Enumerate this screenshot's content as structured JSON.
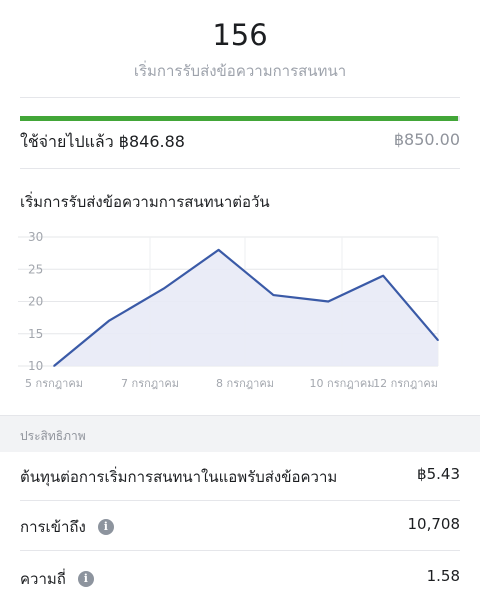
{
  "summary": {
    "count": "156",
    "count_label": "เริ่มการรับส่งข้อความการสนทนา"
  },
  "budget": {
    "spent_label": "ใช้จ่ายไปแล้ว ฿846.88",
    "total_label": "฿850.00",
    "progress_fraction": 0.9963,
    "bar_color": "#42a638"
  },
  "chart": {
    "title": "เริ่มการรับส่งข้อความการสนทนาต่อวัน"
  },
  "chart_data": {
    "type": "area",
    "x_tick_labels": [
      "5 กรกฎาคม",
      "7 กรกฎาคม",
      "8 กรกฎาคม",
      "10 กรกฎาคม",
      "12 กรกฎาคม"
    ],
    "y_tick_labels": [
      "30",
      "25",
      "20",
      "15",
      "10"
    ],
    "ylim": [
      10,
      30
    ],
    "series": [
      {
        "values": [
          10,
          17,
          22,
          28,
          21,
          20,
          24,
          14
        ]
      }
    ],
    "line_color": "#3a5aa7",
    "fill_color": "#e8eaf6",
    "grid": true
  },
  "performance": {
    "section_title": "ประสิทธิภาพ",
    "rows": [
      {
        "label": "ต้นทุนต่อการเริ่มการสนทนาในแอพรับส่งข้อความ",
        "value": "฿5.43",
        "icon": ""
      },
      {
        "label": "การเข้าถึง",
        "value": "10,708",
        "icon": "info-icon"
      },
      {
        "label": "ความถี่",
        "value": "1.58",
        "icon": "info-icon"
      }
    ]
  }
}
